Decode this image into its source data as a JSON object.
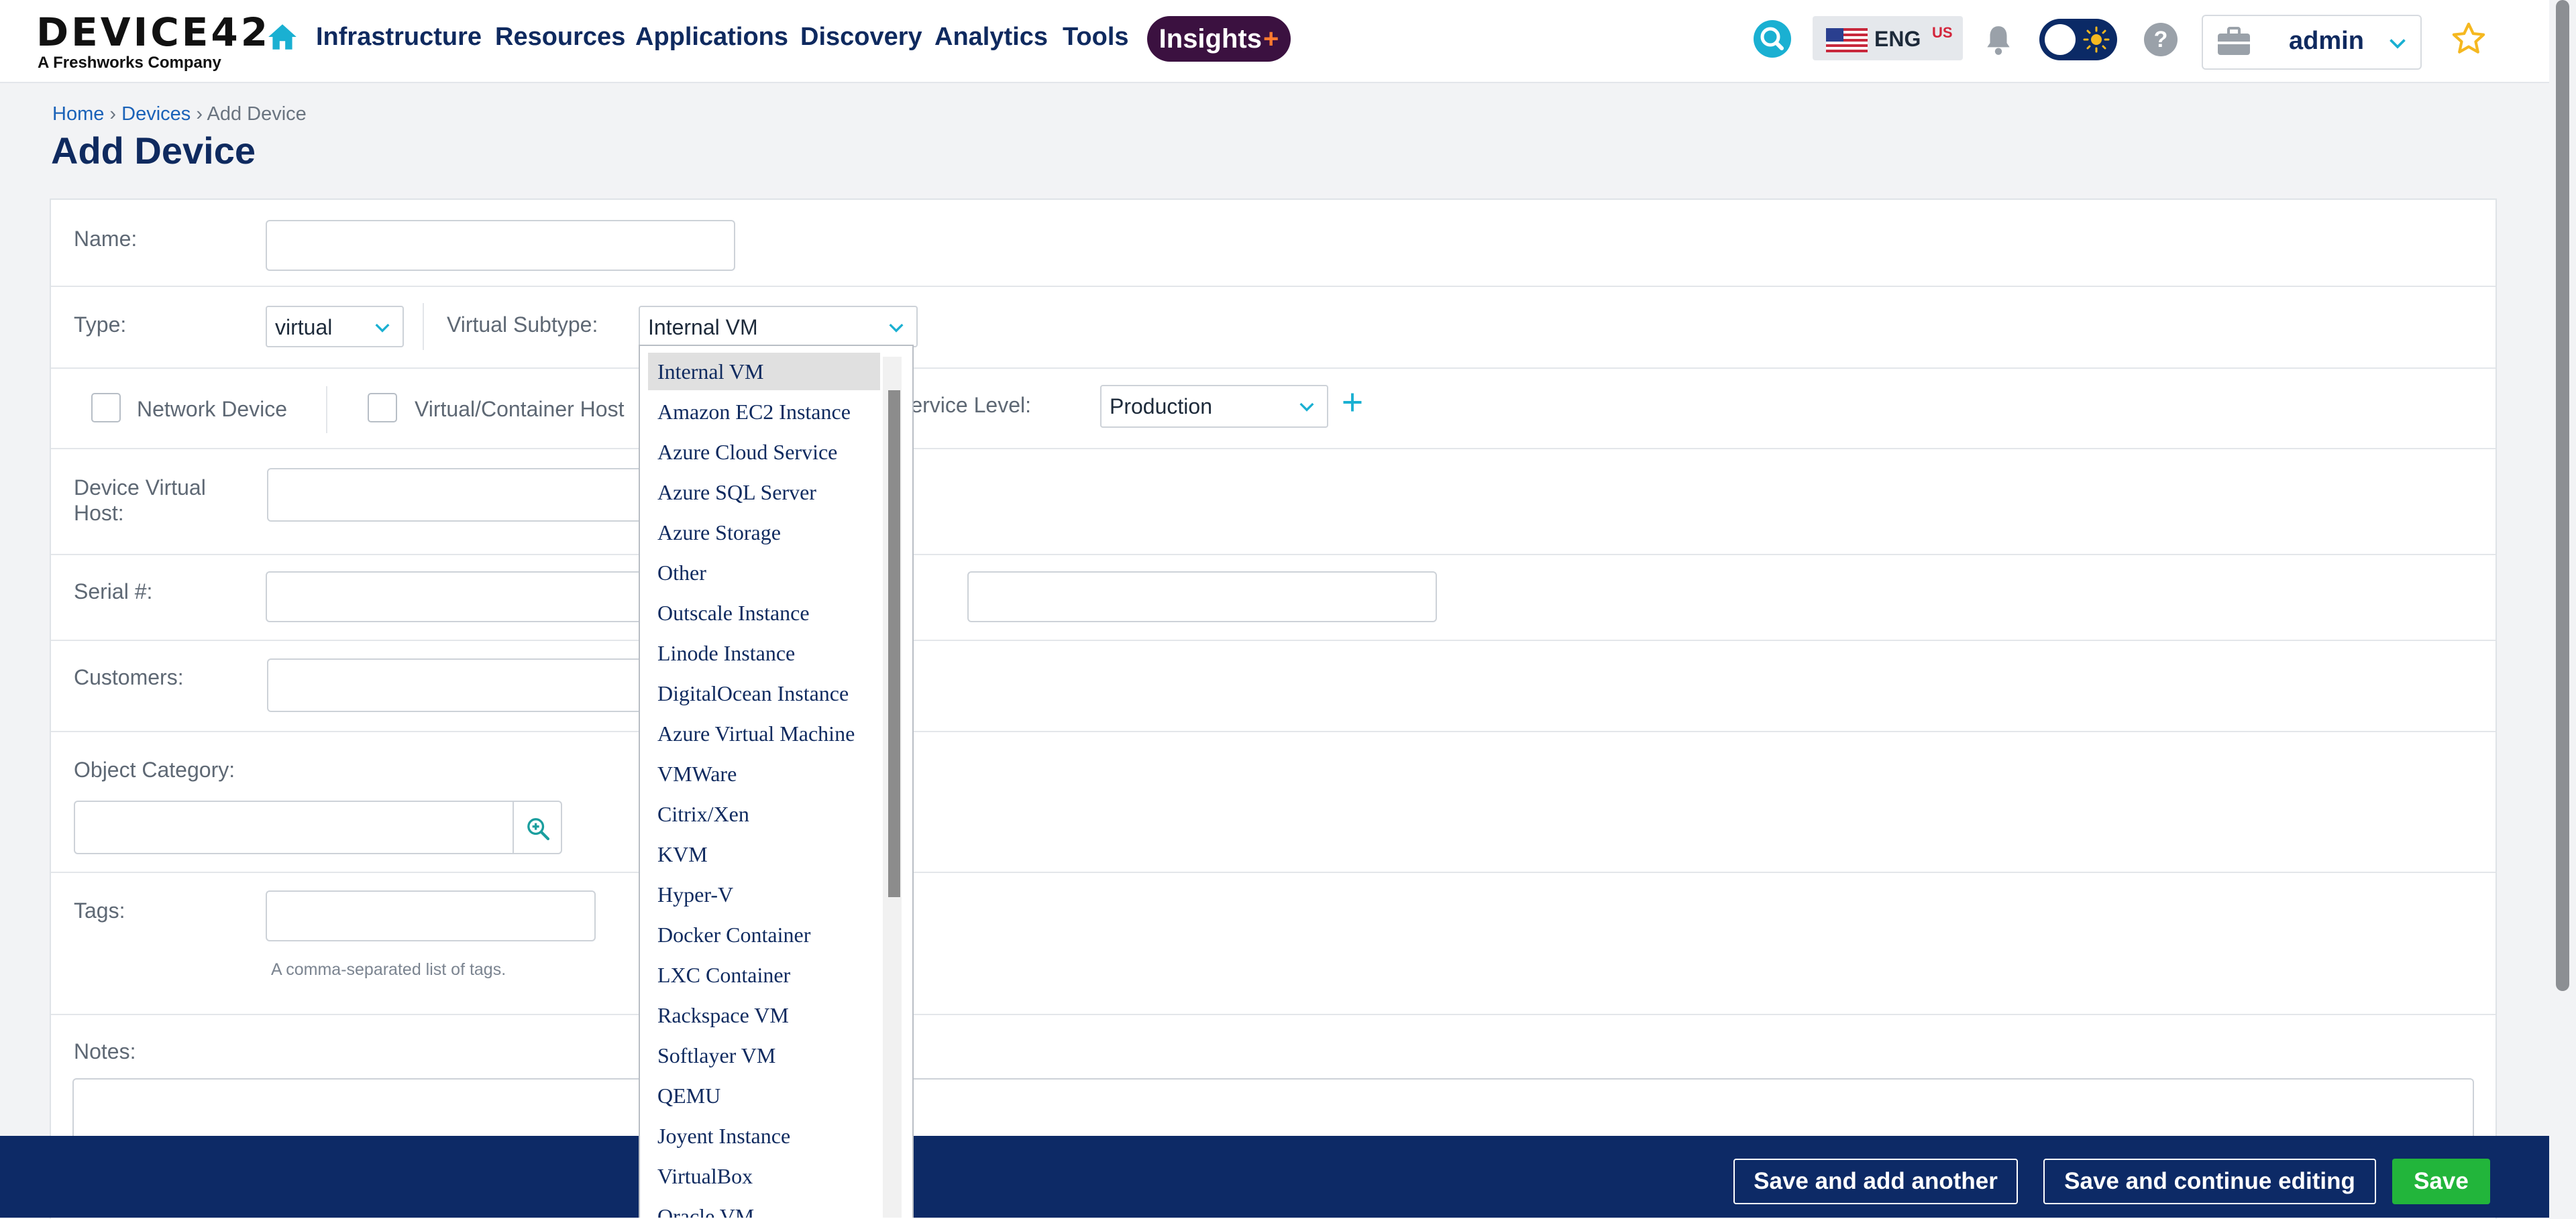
{
  "brand": {
    "logo": "DEVICE42",
    "tagline": "A Freshworks Company"
  },
  "nav": {
    "items": [
      "Infrastructure",
      "Resources",
      "Applications",
      "Discovery",
      "Analytics",
      "Tools"
    ],
    "insights_label": "Insights",
    "insights_plus": "+"
  },
  "header": {
    "language": "ENG",
    "region": "US",
    "help": "?",
    "user": "admin"
  },
  "breadcrumb": {
    "home": "Home",
    "devices": "Devices",
    "current": "Add Device"
  },
  "page_title": "Add Device",
  "form": {
    "name_label": "Name:",
    "name_value": "",
    "type_label": "Type:",
    "type_value": "virtual",
    "virtual_subtype_label": "Virtual Subtype:",
    "virtual_subtype_value": "Internal VM",
    "network_device_label": "Network Device",
    "container_host_label": "Virtual/Container Host",
    "service_level_label": "Service Level:",
    "service_level_value": "Production",
    "device_virtual_host_label": "Device Virtual Host:",
    "serial_label": "Serial #:",
    "customers_label": "Customers:",
    "object_category_label": "Object Category:",
    "tags_label": "Tags:",
    "tags_hint": "A comma-separated list of tags.",
    "notes_label": "Notes:"
  },
  "subtype_options": [
    "Internal VM",
    "Amazon EC2 Instance",
    "Azure Cloud Service",
    "Azure SQL Server",
    "Azure Storage",
    "Other",
    "Outscale Instance",
    "Linode Instance",
    "DigitalOcean Instance",
    "Azure Virtual Machine",
    "VMWare",
    "Citrix/Xen",
    "KVM",
    "Hyper-V",
    "Docker Container",
    "LXC Container",
    "Rackspace VM",
    "Softlayer VM",
    "QEMU",
    "Joyent Instance",
    "VirtualBox",
    "Oracle VM"
  ],
  "subtype_selected_index": 0,
  "actions": {
    "save_add_another": "Save and add another",
    "save_continue": "Save and continue editing",
    "save": "Save"
  },
  "colors": {
    "nav_text": "#0f2a5f",
    "accent_teal": "#1ab0d2",
    "bottom_bar": "#0d2a66",
    "save_green": "#22b53b",
    "insights_bg": "#3b1140"
  }
}
